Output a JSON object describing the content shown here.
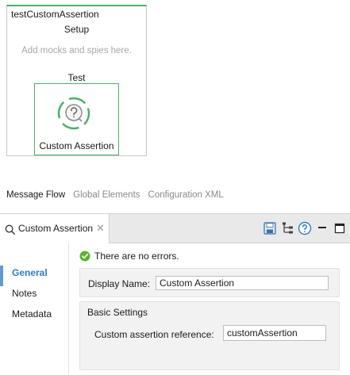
{
  "flow": {
    "title": "testCustomAssertion",
    "setup_label": "Setup",
    "setup_hint": "Add mocks and spies here.",
    "test_label": "Test",
    "processor_label": "Custom Assertion",
    "accent_color": "#4caf6a"
  },
  "editor_tabs": [
    {
      "label": "Message Flow",
      "active": true
    },
    {
      "label": "Global Elements",
      "active": false
    },
    {
      "label": "Configuration XML",
      "active": false
    }
  ],
  "panel": {
    "tab_label": "Custom Assertion",
    "tab_icon": "search-icon",
    "toolbar_icons": [
      "save-icon",
      "tree-icon",
      "help-icon",
      "minimize-icon",
      "maximize-icon"
    ]
  },
  "nav": {
    "items": [
      {
        "label": "General",
        "active": true
      },
      {
        "label": "Notes",
        "active": false
      },
      {
        "label": "Metadata",
        "active": false
      }
    ]
  },
  "status": {
    "text": "There are no errors.",
    "icon": "check-circle-icon"
  },
  "display_name": {
    "label": "Display Name:",
    "value": "Custom Assertion"
  },
  "basic_settings": {
    "title": "Basic Settings",
    "reference_label": "Custom assertion reference:",
    "reference_value": "customAssertion"
  }
}
